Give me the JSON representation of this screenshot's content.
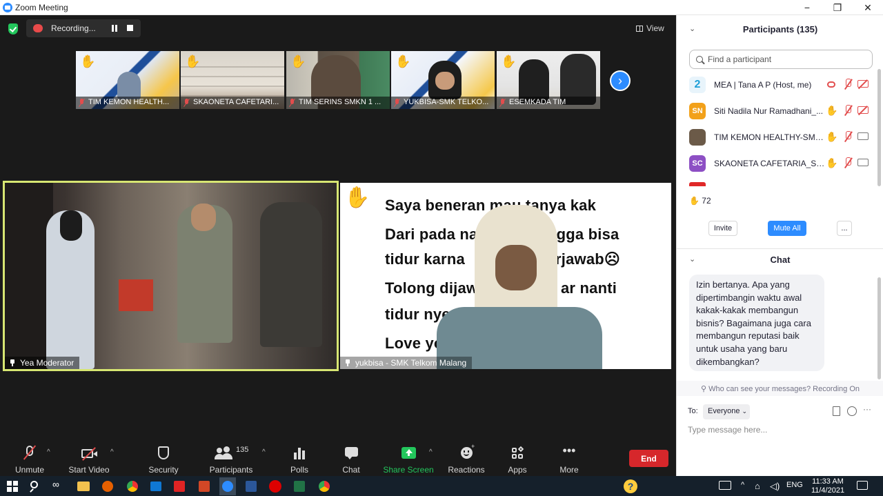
{
  "window": {
    "title": "Zoom Meeting",
    "minimize": "−",
    "restore": "❐",
    "close": "✕"
  },
  "meeting": {
    "recording_label": "Recording...",
    "view_label": "View",
    "next_page_glyph": "›"
  },
  "thumbnails": [
    {
      "name": "TIM KEMON HEALTH..."
    },
    {
      "name": "SKAONETA CAFETARI..."
    },
    {
      "name": "TIM SERINS SMKN 1 ..."
    },
    {
      "name": "YUKBISA-SMK TELKO..."
    },
    {
      "name": "ESEMKADA TIM"
    }
  ],
  "main_videos": {
    "left_name": "Yea Moderator",
    "right_name": "yukbisa - SMK Telkom Malang",
    "slide_lines": [
      "Saya beneran mau tanya kak",
      "Dari pada na",
      "ngga bisa",
      "tidur karna",
      "rjawab☹",
      "Tolong dijaw",
      "ar nanti",
      "tidur nye",
      "Love yo"
    ],
    "hand_glyph": "✋"
  },
  "toolbar": {
    "unmute": "Unmute",
    "start_video": "Start Video",
    "security": "Security",
    "participants": "Participants",
    "participants_count": "135",
    "polls": "Polls",
    "chat": "Chat",
    "share_screen": "Share Screen",
    "reactions": "Reactions",
    "apps": "Apps",
    "more": "More",
    "end": "End"
  },
  "participants_panel": {
    "title": "Participants (135)",
    "search_placeholder": "Find a participant",
    "rows": [
      {
        "initials": "2",
        "name": "MEA | Tana A P (Host, me)",
        "color": "#1fa0d8"
      },
      {
        "initials": "SN",
        "name": "Siti Nadila Nur Ramadhani_...",
        "color": "#f2a11a"
      },
      {
        "initials": "",
        "name": "TIM KEMON HEALTHY-SMK...",
        "color": "#6b5a48"
      },
      {
        "initials": "SC",
        "name": "SKAONETA CAFETARIA_SMK...",
        "color": "#8d4fc4"
      }
    ],
    "raised_hands": "72",
    "invite": "Invite",
    "mute_all": "Mute All",
    "more": "..."
  },
  "chat_panel": {
    "title": "Chat",
    "message": "Izin bertanya. Apa yang dipertimbangin waktu awal kakak-kakak membangun bisnis? Bagaimana juga cara membangun reputasi baik untuk usaha yang baru dikembangkan?",
    "visibility_note": "Who can see your messages? Recording On",
    "to_label": "To:",
    "recipient": "Everyone",
    "input_placeholder": "Type message here..."
  },
  "taskbar": {
    "language": "ENG",
    "time": "11:33 AM",
    "date": "11/4/2021"
  },
  "colors": {
    "zoom_blue": "#2d8cff",
    "end_red": "#d6272b",
    "share_green": "#23c65c",
    "active_speaker": "#d7e672"
  }
}
